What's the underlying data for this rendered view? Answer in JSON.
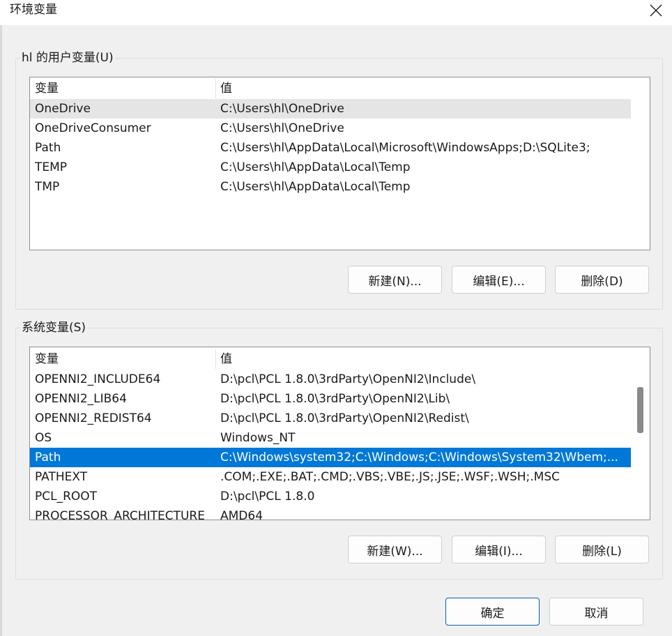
{
  "window": {
    "title": "环境变量"
  },
  "user_vars": {
    "group_label": "hl 的用户变量(U)",
    "headers": {
      "name": "变量",
      "value": "值"
    },
    "rows": [
      {
        "name": "OneDrive",
        "value": "C:\\Users\\hl\\OneDrive"
      },
      {
        "name": "OneDriveConsumer",
        "value": "C:\\Users\\hl\\OneDrive"
      },
      {
        "name": "Path",
        "value": "C:\\Users\\hl\\AppData\\Local\\Microsoft\\WindowsApps;D:\\SQLite3;"
      },
      {
        "name": "TEMP",
        "value": "C:\\Users\\hl\\AppData\\Local\\Temp"
      },
      {
        "name": "TMP",
        "value": "C:\\Users\\hl\\AppData\\Local\\Temp"
      }
    ],
    "buttons": {
      "new": "新建(N)...",
      "edit": "编辑(E)...",
      "delete": "删除(D)"
    }
  },
  "system_vars": {
    "group_label": "系统变量(S)",
    "headers": {
      "name": "变量",
      "value": "值"
    },
    "rows": [
      {
        "name": "OPENNI2_INCLUDE64",
        "value": "D:\\pcl\\PCL 1.8.0\\3rdParty\\OpenNI2\\Include\\"
      },
      {
        "name": "OPENNI2_LIB64",
        "value": "D:\\pcl\\PCL 1.8.0\\3rdParty\\OpenNI2\\Lib\\"
      },
      {
        "name": "OPENNI2_REDIST64",
        "value": "D:\\pcl\\PCL 1.8.0\\3rdParty\\OpenNI2\\Redist\\"
      },
      {
        "name": "OS",
        "value": "Windows_NT"
      },
      {
        "name": "Path",
        "value": "C:\\Windows\\system32;C:\\Windows;C:\\Windows\\System32\\Wbem;..."
      },
      {
        "name": "PATHEXT",
        "value": ".COM;.EXE;.BAT;.CMD;.VBS;.VBE;.JS;.JSE;.WSF;.WSH;.MSC"
      },
      {
        "name": "PCL_ROOT",
        "value": "D:\\pcl\\PCL 1.8.0"
      },
      {
        "name": "PROCESSOR_ARCHITECTURE",
        "value": "AMD64"
      }
    ],
    "buttons": {
      "new": "新建(W)...",
      "edit": "编辑(I)...",
      "delete": "删除(L)"
    }
  },
  "footer": {
    "ok": "确定",
    "cancel": "取消"
  },
  "colors": {
    "selection": "#0078d7",
    "hover_row": "#e5e5e5",
    "primary_border": "#005fb8"
  }
}
